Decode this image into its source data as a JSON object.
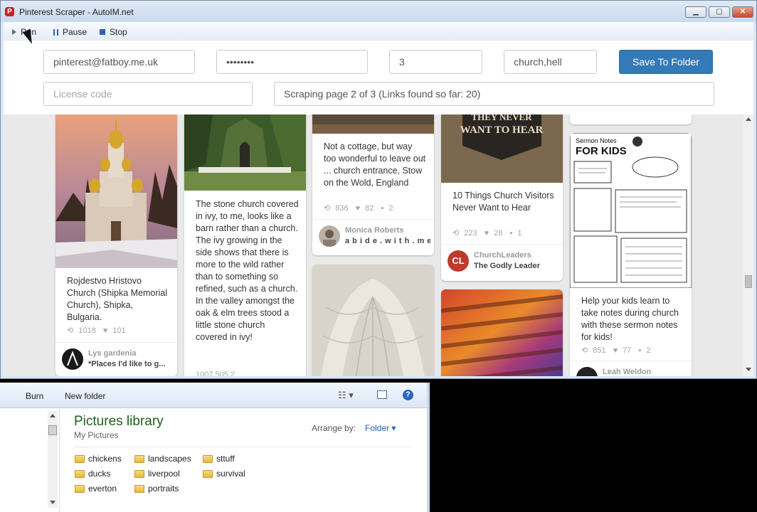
{
  "window": {
    "title": "Pinterest Scraper - AutoIM.net",
    "controls": {
      "minimize": "▁",
      "maximize": "▢",
      "close": "✕"
    }
  },
  "toolbar": {
    "run": "Run",
    "pause": "Pause",
    "stop": "Stop"
  },
  "form": {
    "email": "pinterest@fatboy.me.uk",
    "password": "••••••••",
    "pages": "3",
    "keywords": "church,hell",
    "save_button": "Save To Folder",
    "license_placeholder": "License code",
    "status": "Scraping page 2 of 3 (Links found so far: 20)"
  },
  "pins": {
    "p1": {
      "description": "Rojdestvo Hristovo Church (Shipka Memorial Church), Shipka, Bulgaria.",
      "repins": "1018",
      "likes": "101",
      "pinner": "Lys gardenia",
      "board": "*Places I'd like to g..."
    },
    "p2": {
      "description": "The stone church covered in ivy, to me, looks like a barn rather than a church. The ivy growing in the side shows that there is more to the wild rather than to something so refined, such as a church. In the valley amongst the oak & elm trees stood a little stone church covered in ivy!",
      "stats_partial": "1007   505   2"
    },
    "p3": {
      "description": "Not a cottage, but way too wonderful to leave out ... church entrance, Stow on the Wold, England",
      "repins": "836",
      "likes": "82",
      "comments": "2",
      "pinner": "Monica Roberts",
      "board": "a b i d e . w i t h . m e"
    },
    "p4": {
      "image_text": "THEY NEVER WANT TO HEAR",
      "description": "10 Things Church Visitors Never Want to Hear",
      "repins": "223",
      "likes": "28",
      "comments": "1",
      "pinner": "ChurchLeaders",
      "board": "The Godly Leader",
      "avatar_text": "CL"
    },
    "p5": {
      "image_title": "Sermon Notes FOR KIDS",
      "description": "Help your kids learn to take notes during church with these sermon notes for kids!",
      "repins": "851",
      "likes": "77",
      "comments": "2",
      "pinner": "Leah Weldon"
    }
  },
  "explorer": {
    "toolbar": {
      "burn": "Burn",
      "new_folder": "New folder"
    },
    "library_title": "Pictures library",
    "library_sub": "My Pictures",
    "arrange_label": "Arrange by:",
    "arrange_value": "Folder",
    "folders": [
      "chickens",
      "ducks",
      "everton",
      "landscapes",
      "liverpool",
      "portraits",
      "sttuff",
      "survival"
    ]
  },
  "colors": {
    "accent": "#337ab7",
    "pinterest_red": "#cb2027",
    "library_green": "#1e5f1e"
  },
  "icons": [
    "pinterest-icon",
    "play-icon",
    "pause-icon",
    "stop-icon",
    "repin-icon",
    "heart-icon",
    "comment-icon",
    "folder-icon",
    "view-icon",
    "pane-icon",
    "help-icon"
  ]
}
